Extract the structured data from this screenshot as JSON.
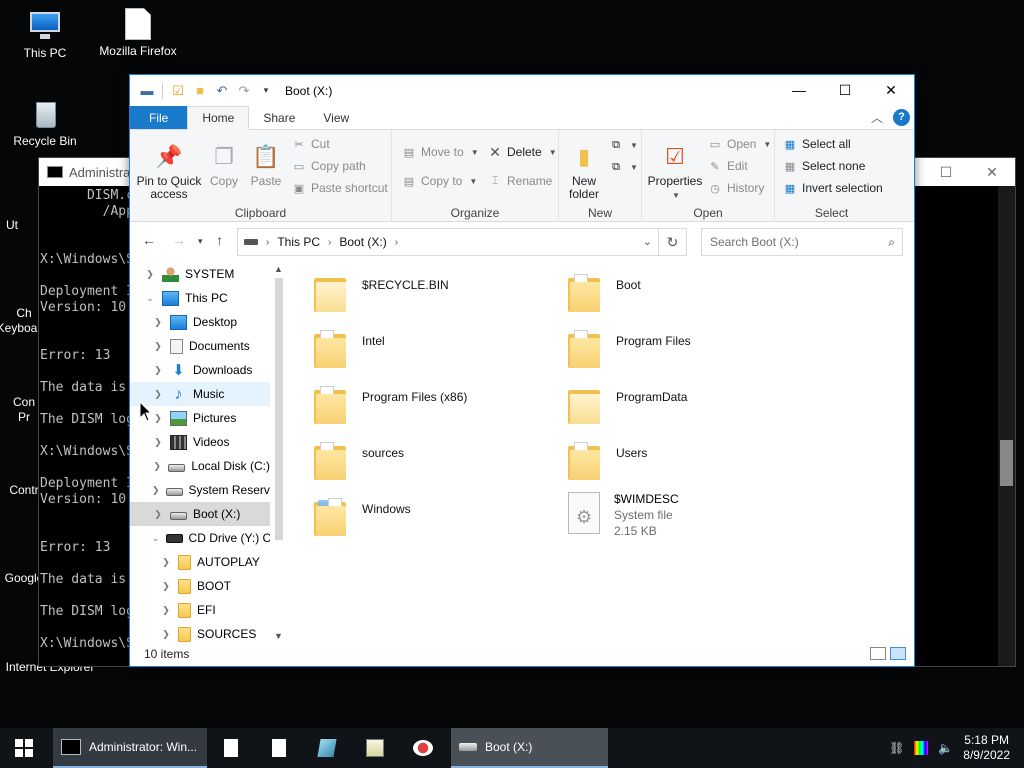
{
  "desktop": {
    "icons": [
      {
        "label": "This PC"
      },
      {
        "label": "Mozilla Firefox"
      },
      {
        "label": "Recycle Bin"
      }
    ],
    "partial_labels": [
      "Ut",
      "Ch",
      "Keyboa",
      "Con",
      "Pr",
      "Contr",
      "Google",
      "Internet Explorer"
    ]
  },
  "cmd_window": {
    "title": "Administrat",
    "lines": [
      "      DISM.c",
      "        /App",
      "",
      "",
      "X:\\Windows\\S",
      "",
      "Deployment I",
      "Version: 10",
      "",
      "",
      "Error: 13",
      "",
      "The data is",
      "",
      "The DISM log",
      "",
      "X:\\Windows\\S",
      "",
      "Deployment I",
      "Version: 10",
      "",
      "",
      "Error: 13",
      "",
      "The data is",
      "",
      "The DISM log",
      "",
      "X:\\Windows\\S"
    ]
  },
  "explorer": {
    "title": "Boot (X:)",
    "tabs": {
      "file": "File",
      "home": "Home",
      "share": "Share",
      "view": "View"
    },
    "ribbon": {
      "clipboard": {
        "label": "Clipboard",
        "pin": "Pin to Quick access",
        "copy": "Copy",
        "paste": "Paste",
        "cut": "Cut",
        "copy_path": "Copy path",
        "paste_shortcut": "Paste shortcut"
      },
      "organize": {
        "label": "Organize",
        "move_to": "Move to",
        "copy_to": "Copy to",
        "delete": "Delete",
        "rename": "Rename"
      },
      "new": {
        "label": "New",
        "new_folder": "New folder"
      },
      "open": {
        "label": "Open",
        "properties": "Properties",
        "open": "Open",
        "edit": "Edit",
        "history": "History"
      },
      "select": {
        "label": "Select",
        "select_all": "Select all",
        "select_none": "Select none",
        "invert": "Invert selection"
      }
    },
    "address": {
      "crumbs": [
        "This PC",
        "Boot (X:)"
      ],
      "search_placeholder": "Search Boot (X:)"
    },
    "nav": [
      {
        "label": "SYSTEM",
        "icon": "user-folder-icon"
      },
      {
        "label": "This PC",
        "icon": "computer-icon"
      },
      {
        "label": "Desktop",
        "icon": "desktop-icon"
      },
      {
        "label": "Documents",
        "icon": "documents-icon"
      },
      {
        "label": "Downloads",
        "icon": "downloads-icon"
      },
      {
        "label": "Music",
        "icon": "music-icon"
      },
      {
        "label": "Pictures",
        "icon": "pictures-icon"
      },
      {
        "label": "Videos",
        "icon": "videos-icon"
      },
      {
        "label": "Local Disk (C:)",
        "icon": "drive-icon"
      },
      {
        "label": "System Reserved",
        "icon": "drive-icon"
      },
      {
        "label": "Boot (X:)",
        "icon": "drive-icon"
      },
      {
        "label": "CD Drive (Y:) C",
        "icon": "cd-drive-icon"
      },
      {
        "label": "AUTOPLAY",
        "icon": "folder-icon"
      },
      {
        "label": "BOOT",
        "icon": "folder-icon"
      },
      {
        "label": "EFI",
        "icon": "folder-icon"
      },
      {
        "label": "SOURCES",
        "icon": "folder-icon"
      }
    ],
    "items": [
      {
        "name": "$RECYCLE.BIN"
      },
      {
        "name": "Boot"
      },
      {
        "name": "Intel"
      },
      {
        "name": "Program Files"
      },
      {
        "name": "Program Files (x86)"
      },
      {
        "name": "ProgramData"
      },
      {
        "name": "sources"
      },
      {
        "name": "Users"
      },
      {
        "name": "Windows"
      },
      {
        "name": "$WIMDESC",
        "type": "System file",
        "size": "2.15 KB"
      }
    ],
    "status": "10 items"
  },
  "taskbar": {
    "cmd_label": "Administrator: Win...",
    "explorer_label": "Boot (X:)",
    "time": "5:18 PM",
    "date": "8/9/2022"
  },
  "colors": {
    "accent": "#1979ca",
    "desktop": "#050608",
    "taskbar": "#101418"
  }
}
